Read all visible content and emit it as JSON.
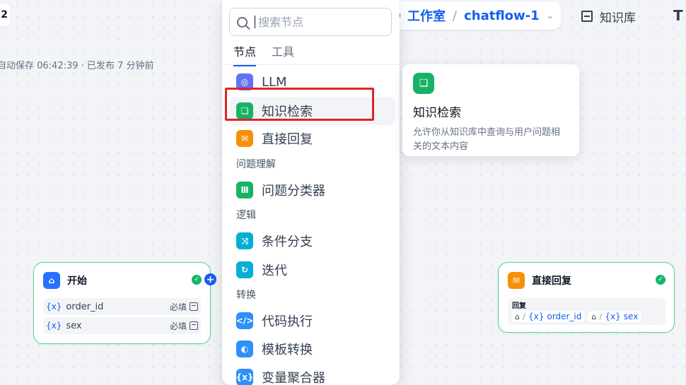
{
  "header": {
    "partial_left": "2",
    "autosave": "自动保存 06:42:39 · 已发布 7 分钟前",
    "breadcrumb": {
      "workspace": "工作室",
      "separator": "/",
      "app": "chatflow-1"
    },
    "knowledge_link": "知识库"
  },
  "picker": {
    "search_placeholder": "搜索节点",
    "tabs": [
      "节点",
      "工具"
    ],
    "items": {
      "llm": "LLM",
      "knowledge": "知识检索",
      "answer": "直接回复",
      "classifier": "问题分类器",
      "if_else": "条件分支",
      "iteration": "迭代",
      "code": "代码执行",
      "template": "模板转换",
      "aggregator": "变量聚合器"
    },
    "groups": {
      "question": "问题理解",
      "logic": "逻辑",
      "transform": "转换"
    },
    "colors": {
      "llm": "#6172f3",
      "knowledge": "#16b364",
      "answer": "#f79009",
      "classifier": "#16b364",
      "if_else": "#06aed4",
      "iteration": "#06aed4",
      "code": "#2e90fa",
      "template": "#2e90fa",
      "aggregator": "#2e90fa"
    }
  },
  "tooltip": {
    "title": "知识检索",
    "description": "允许你从知识库中查询与用户问题相关的文本内容"
  },
  "start_node": {
    "title": "开始",
    "vars": [
      {
        "name": "order_id",
        "required": "必填"
      },
      {
        "name": "sex",
        "required": "必填"
      }
    ]
  },
  "answer_node": {
    "title": "直接回复",
    "label": "回复",
    "refs": [
      "order_id",
      "sex"
    ]
  }
}
